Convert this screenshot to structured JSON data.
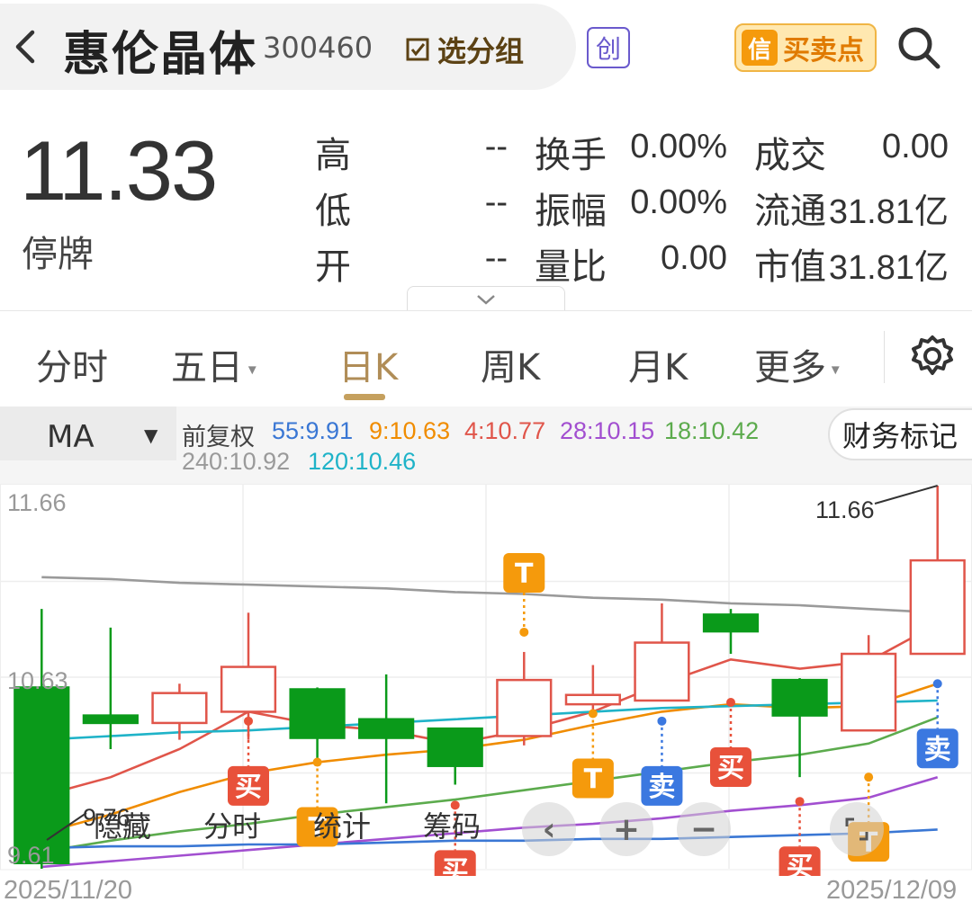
{
  "header": {
    "stock_name": "惠伦晶体",
    "stock_code": "300460",
    "watch_label": "选分组",
    "board_badge": "创",
    "signal_logo": "信",
    "signal_label": "买卖点"
  },
  "quote": {
    "price": "11.33",
    "status": "停牌",
    "rows": [
      {
        "l1": "高",
        "v1": "--",
        "l2": "换手",
        "v2": "0.00%",
        "l3": "成交",
        "v3": "0.00"
      },
      {
        "l1": "低",
        "v1": "--",
        "l2": "振幅",
        "v2": "0.00%",
        "l3": "流通",
        "v3": "31.81亿"
      },
      {
        "l1": "开",
        "v1": "--",
        "l2": "量比",
        "v2": "0.00",
        "l3": "市值",
        "v3": "31.81亿"
      }
    ]
  },
  "tabs": [
    "分时",
    "五日",
    "日K",
    "周K",
    "月K",
    "更多"
  ],
  "active_tab": "日K",
  "indicator": {
    "name": "MA",
    "adjust": "前复权",
    "ma_items": [
      {
        "text": "55:9.91",
        "color": "#3a77d4"
      },
      {
        "text": "9:10.63",
        "color": "#f08c00"
      },
      {
        "text": "4:10.77",
        "color": "#e0554a"
      },
      {
        "text": "28:10.15",
        "color": "#a24fd0"
      },
      {
        "text": "18:10.42",
        "color": "#5cab4d"
      },
      {
        "text": "240:10.92",
        "color": "#9a9a9a"
      },
      {
        "text": "120:10.46",
        "color": "#1fb3c8"
      }
    ],
    "finance_button": "财务标记"
  },
  "chart_data": {
    "type": "candlestick",
    "y_ticks": [
      "11.66",
      "10.63",
      "9.61"
    ],
    "ylim": [
      9.61,
      11.66
    ],
    "x_start": "2025/11/20",
    "x_end": "2025/12/09",
    "max_label": "11.66",
    "min_label": "9.76",
    "candles": [
      {
        "o": 10.58,
        "c": 9.64,
        "h": 11.0,
        "l": 9.61
      },
      {
        "o": 10.43,
        "c": 10.39,
        "h": 10.9,
        "l": 10.25
      },
      {
        "o": 10.39,
        "c": 10.55,
        "h": 10.6,
        "l": 10.3
      },
      {
        "o": 10.45,
        "c": 10.69,
        "h": 10.98,
        "l": 10.3
      },
      {
        "o": 10.57,
        "c": 10.31,
        "h": 10.58,
        "l": 10.2
      },
      {
        "o": 10.41,
        "c": 10.31,
        "h": 10.65,
        "l": 9.96
      },
      {
        "o": 10.36,
        "c": 10.16,
        "h": 10.36,
        "l": 10.06
      },
      {
        "o": 10.32,
        "c": 10.62,
        "h": 10.77,
        "l": 10.27
      },
      {
        "o": 10.49,
        "c": 10.54,
        "h": 10.7,
        "l": 10.44
      },
      {
        "o": 10.51,
        "c": 10.82,
        "h": 11.03,
        "l": 10.51
      },
      {
        "o": 10.97,
        "c": 10.88,
        "h": 11.0,
        "l": 10.76
      },
      {
        "o": 10.62,
        "c": 10.43,
        "h": 10.63,
        "l": 10.1
      },
      {
        "o": 10.35,
        "c": 10.76,
        "h": 10.86,
        "l": 10.35
      },
      {
        "o": 10.76,
        "c": 11.26,
        "h": 11.66,
        "l": 10.76
      }
    ],
    "series": [
      {
        "name": "4",
        "color": "#e0554a",
        "values": [
          10.0,
          10.1,
          10.25,
          10.45,
          10.38,
          10.35,
          10.28,
          10.35,
          10.45,
          10.6,
          10.73,
          10.68,
          10.72,
          10.92
        ]
      },
      {
        "name": "9",
        "color": "#f08c00",
        "values": [
          9.8,
          9.9,
          10.02,
          10.12,
          10.18,
          10.22,
          10.25,
          10.3,
          10.38,
          10.45,
          10.49,
          10.47,
          10.48,
          10.6
        ]
      },
      {
        "name": "18",
        "color": "#5cab4d",
        "values": [
          9.7,
          9.76,
          9.81,
          9.85,
          9.9,
          9.94,
          9.98,
          10.03,
          10.08,
          10.13,
          10.18,
          10.22,
          10.28,
          10.42
        ]
      },
      {
        "name": "28",
        "color": "#a24fd0",
        "values": [
          9.62,
          9.65,
          9.68,
          9.71,
          9.74,
          9.77,
          9.8,
          9.83,
          9.85,
          9.88,
          9.92,
          9.95,
          9.99,
          10.1
        ]
      },
      {
        "name": "55",
        "color": "#3a77d4",
        "values": [
          9.72,
          9.73,
          9.73,
          9.74,
          9.74,
          9.75,
          9.76,
          9.76,
          9.77,
          9.77,
          9.78,
          9.79,
          9.8,
          9.82
        ]
      },
      {
        "name": "120",
        "color": "#1fb3c8",
        "values": [
          10.3,
          10.32,
          10.34,
          10.35,
          10.37,
          10.39,
          10.41,
          10.43,
          10.45,
          10.47,
          10.48,
          10.49,
          10.5,
          10.51
        ]
      },
      {
        "name": "240",
        "color": "#9a9a9a",
        "values": [
          11.17,
          11.16,
          11.14,
          11.13,
          11.12,
          11.11,
          11.09,
          11.08,
          11.06,
          11.05,
          11.03,
          11.02,
          11.0,
          10.98
        ]
      }
    ],
    "signals": [
      {
        "i": 3,
        "label": "买",
        "type": "buy",
        "side": "below",
        "value": 10.4
      },
      {
        "i": 4,
        "label": "T",
        "type": "t",
        "side": "below",
        "value": 10.18
      },
      {
        "i": 6,
        "label": "买",
        "type": "buy",
        "side": "below",
        "value": 9.95
      },
      {
        "i": 7,
        "label": "T",
        "type": "t",
        "side": "above",
        "value": 10.77
      },
      {
        "i": 8,
        "label": "T",
        "type": "t",
        "side": "below",
        "value": 10.44
      },
      {
        "i": 9,
        "label": "卖",
        "type": "sell",
        "side": "below",
        "value": 10.4
      },
      {
        "i": 10,
        "label": "买",
        "type": "buy",
        "side": "below",
        "value": 10.5
      },
      {
        "i": 11,
        "label": "买",
        "type": "buy",
        "side": "below",
        "value": 9.97
      },
      {
        "i": 12,
        "label": "T",
        "type": "t",
        "side": "below",
        "value": 10.1
      },
      {
        "i": 13,
        "label": "卖",
        "type": "sell",
        "side": "below",
        "value": 10.6
      }
    ]
  },
  "chart_tools": {
    "hide": "隐藏",
    "intraday": "分时",
    "stats": "统计",
    "chips": "筹码"
  },
  "colors": {
    "up": "#e0554a",
    "down": "#0a9a1a",
    "buy_tag": "#e8513a",
    "sell_tag": "#3b78e0",
    "t_tag": "#f59a0c",
    "accent": "#c5a05e"
  }
}
